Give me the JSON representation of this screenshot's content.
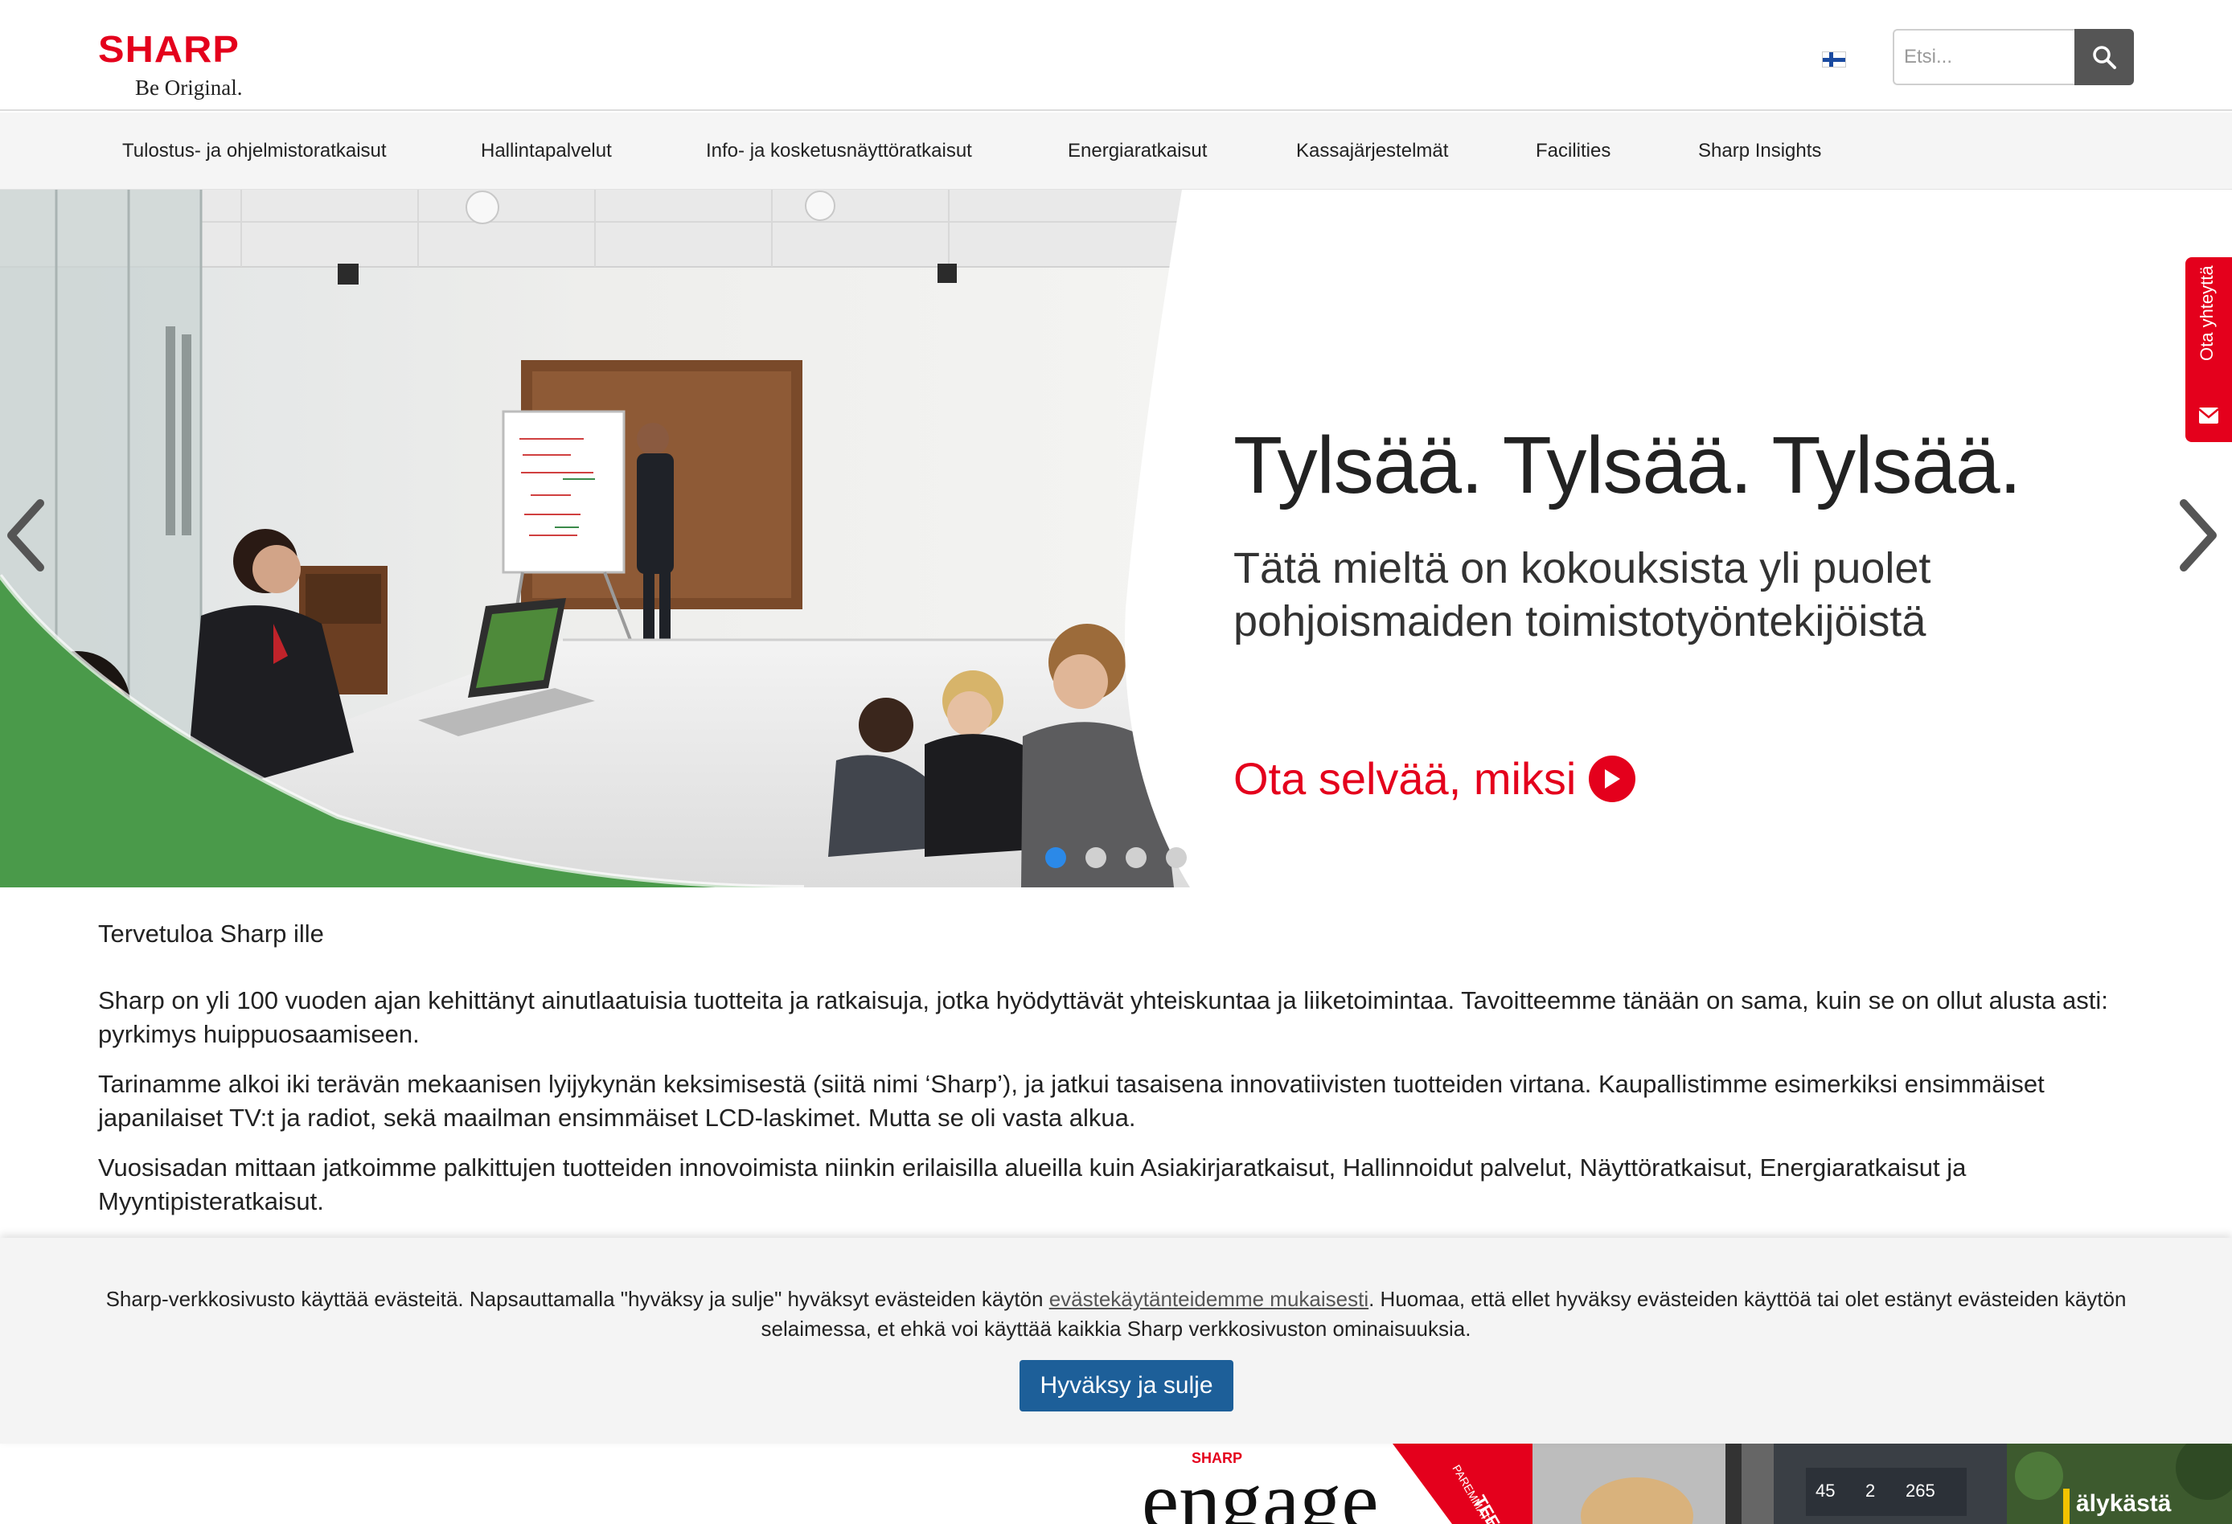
{
  "header": {
    "logo_text": "SHARP",
    "logo_tagline": "Be Original.",
    "search_placeholder": "Etsi..."
  },
  "nav": {
    "items": [
      {
        "label": "Tulostus- ja ohjelmistoratkaisut"
      },
      {
        "label": "Hallintapalvelut"
      },
      {
        "label": "Info- ja kosketusnäyttöratkaisut"
      },
      {
        "label": "Energiaratkaisut"
      },
      {
        "label": "Kassajärjestelmät"
      },
      {
        "label": "Facilities"
      },
      {
        "label": "Sharp Insights"
      }
    ]
  },
  "hero": {
    "title": "Tylsää. Tylsää. Tylsää.",
    "subtitle_line1": "Tätä mieltä on kokouksista yli puolet",
    "subtitle_line2": "pohjoismaiden toimistotyöntekijöistä",
    "cta": "Ota selvää, miksi",
    "slides_total": 4,
    "active_slide": 1
  },
  "contact_tab": {
    "label": "Ota yhteyttä"
  },
  "intro": {
    "heading": "Tervetuloa Sharp ille",
    "paragraphs": [
      "Sharp on yli 100 vuoden ajan kehittänyt ainutlaatuisia tuotteita ja ratkaisuja, jotka hyödyttävät yhteiskuntaa ja liiketoimintaa. Tavoitteemme tänään on sama, kuin se on ollut alusta asti: pyrkimys huippuosaamiseen.",
      "Tarinamme alkoi iki terävän mekaanisen lyijykynän keksimisestä (siitä nimi ‘Sharp’), ja jatkui tasaisena  innovatiivisten tuotteiden virtana. Kaupallistimme esimerkiksi ensimmäiset japanilaiset TV:t ja radiot, sekä maailman ensimmäiset LCD-laskimet. Mutta se oli vasta alkua.",
      "Vuosisadan mittaan jatkoimme palkittujen tuotteiden innovoimista niinkin erilaisilla alueilla kuin Asiakirjaratkaisut, Hallinnoidut palvelut, Näyttöratkaisut, Energiaratkaisut ja Myyntipisteratkaisut."
    ]
  },
  "cookie_banner": {
    "text_before": "Sharp-verkkosivusto käyttää evästeitä. Napsauttamalla \"hyväksy ja sulje\" hyväksyt evästeiden käytön ",
    "link_text": "evästekäytänteidemme mukaisesti",
    "text_after": ". Huomaa, että ellet hyväksy evästeiden käyttöä tai olet estänyt evästeiden käytön selaimessa, et ehkä voi käyttää kaikkia Sharp verkkosivuston ominaisuuksia.",
    "button_label": "Hyväksy ja sulje"
  },
  "tiles": {
    "engage_brand": "SHARP",
    "engage_title": "engage",
    "engage_ribbon": "TEEMA",
    "engage_ribbon_sub": "PAREMMAT KOKO",
    "dashboard_values": [
      "45",
      "2",
      "265"
    ],
    "smart_title": "älykästä"
  },
  "colors": {
    "brand_red": "#e4001c",
    "nav_bg": "#f5f5f5",
    "cookie_button": "#1d5f99",
    "dot_active": "#2b89e8",
    "hero_green": "#4a9a4a"
  }
}
